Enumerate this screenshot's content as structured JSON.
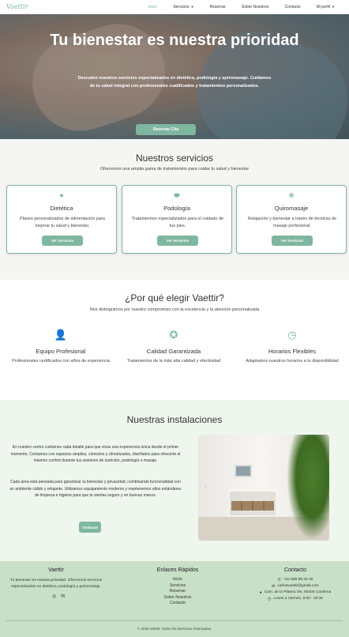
{
  "brand": {
    "logo": "Vaettir",
    "accent": "#7fb6a0"
  },
  "nav": {
    "items": [
      {
        "label": "Inicio",
        "active": true
      },
      {
        "label": "Servicios",
        "active": false,
        "dropdown": true
      },
      {
        "label": "Reservar",
        "active": false
      },
      {
        "label": "Sobre Nosotros",
        "active": false
      },
      {
        "label": "Contacto",
        "active": false
      },
      {
        "label": "Mi perfil",
        "active": false,
        "dropdown": true
      }
    ]
  },
  "hero": {
    "title": "Tu bienestar es nuestra prioridad",
    "subtitle": "Descubre nuestros servicios especializados en dietética, podología y quiromasaje. Cuidamos de tu salud integral con profesionales cualificados y tratamientos personalizados.",
    "cta": "Reservar Cita"
  },
  "services": {
    "title": "Nuestros servicios",
    "subtitle": "Ofrecemos una amplia gama de tratamientos para cuidar tu salud y bienestar",
    "cards": [
      {
        "icon": "apple-icon",
        "title": "Dietética",
        "desc": "Planes personalizados de alimentación para mejorar tu salud y bienestar.",
        "button": "Ver Servicios"
      },
      {
        "icon": "pills-icon",
        "title": "Podología",
        "desc": "Tratamientos especializados para el cuidado de tus pies.",
        "button": "Ver Servicios"
      },
      {
        "icon": "lotus-icon",
        "title": "Quiromasaje",
        "desc": "Relajación y bienestar a través de técnicas de masaje profesional.",
        "button": "Ver Servicios"
      }
    ]
  },
  "why": {
    "title": "¿Por qué elegir Vaettir?",
    "subtitle": "Nos distinguimos por nuestro compromiso con la excelencia y la atención personalizada",
    "features": [
      {
        "icon": "doctor-icon",
        "title": "Equipo Profesional",
        "desc": "Profesionales certificados con años de experiencia"
      },
      {
        "icon": "certificate-icon",
        "title": "Calidad Garantizada",
        "desc": "Tratamientos de la más alta calidad y efectividad"
      },
      {
        "icon": "clock-icon",
        "title": "Horarios Flexibles",
        "desc": "Adaptamos nuestros horarios a tu disponibilidad"
      }
    ]
  },
  "facilities": {
    "title": "Nuestras instalaciones",
    "paragraph1": "En nuestro centro cuidamos cada detalle para que vivas una experiencia única desde el primer momento. Contamos con espacios amplios, cómodos y climatizados, diseñados para ofrecerte el máximo confort durante tus sesiones de nutrición, podología o masaje.",
    "paragraph2": "Cada área está pensada para garantizar tu bienestar y privacidad, combinando funcionalidad con un ambiente cálido y relajante. Utilizamos equipamiento moderno y mantenemos altos estándares de limpieza e higiene para que te sientas seguro y en buenas manos.",
    "button": "Visítanos"
  },
  "footer": {
    "about_title": "Vaettir",
    "about_text": "Tu bienestar es nuestra prioridad. Ofrecemos servicios especializados en dietética, podología y quiromasaje.",
    "links_title": "Enlaces Rápidos",
    "links": [
      "Inicio",
      "Servicios",
      "Reservar",
      "Sobre Nosotros",
      "Contacto"
    ],
    "contact_title": "Contacto",
    "contact": [
      {
        "icon": "phone-icon",
        "text": "+34 686 98 33 45"
      },
      {
        "icon": "mail-icon",
        "text": "carlosvaettir@gmail.com"
      },
      {
        "icon": "location-icon",
        "text": "Cam. de la Platera SN, 50400 Cariñena"
      },
      {
        "icon": "clock-icon",
        "text": "Lunes a Viernes, 9:00 - 20:30"
      }
    ],
    "copyright": "© 2025 Vaettir. Todos los derechos reservados."
  }
}
